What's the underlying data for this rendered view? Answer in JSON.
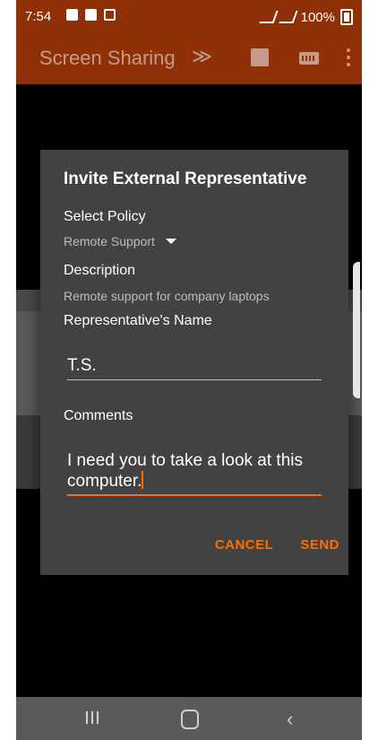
{
  "status": {
    "time": "7:54",
    "battery": "100%"
  },
  "appbar": {
    "title": "Screen Sharing",
    "chevron": "≫",
    "icons": [
      "stop-icon",
      "keyboard-icon",
      "more-vert-icon"
    ]
  },
  "dialog": {
    "title": "Invite External Representative",
    "select_policy_label": "Select Policy",
    "policy_value": "Remote Support",
    "description_label": "Description",
    "description_value": "Remote support for company laptops",
    "rep_name_label": "Representative's Name",
    "rep_name_value": "T.S.",
    "comments_label": "Comments",
    "comments_value": "I need you to take a look at this computer.",
    "cancel": "CANCEL",
    "send": "SEND"
  },
  "navbar": {
    "icons": [
      "recent-apps-icon",
      "home-icon",
      "back-icon"
    ],
    "back_glyph": "‹"
  },
  "colors": {
    "app_bar": "#8f3007",
    "dialog_bg": "#424242",
    "accent": "#ff6d00"
  }
}
